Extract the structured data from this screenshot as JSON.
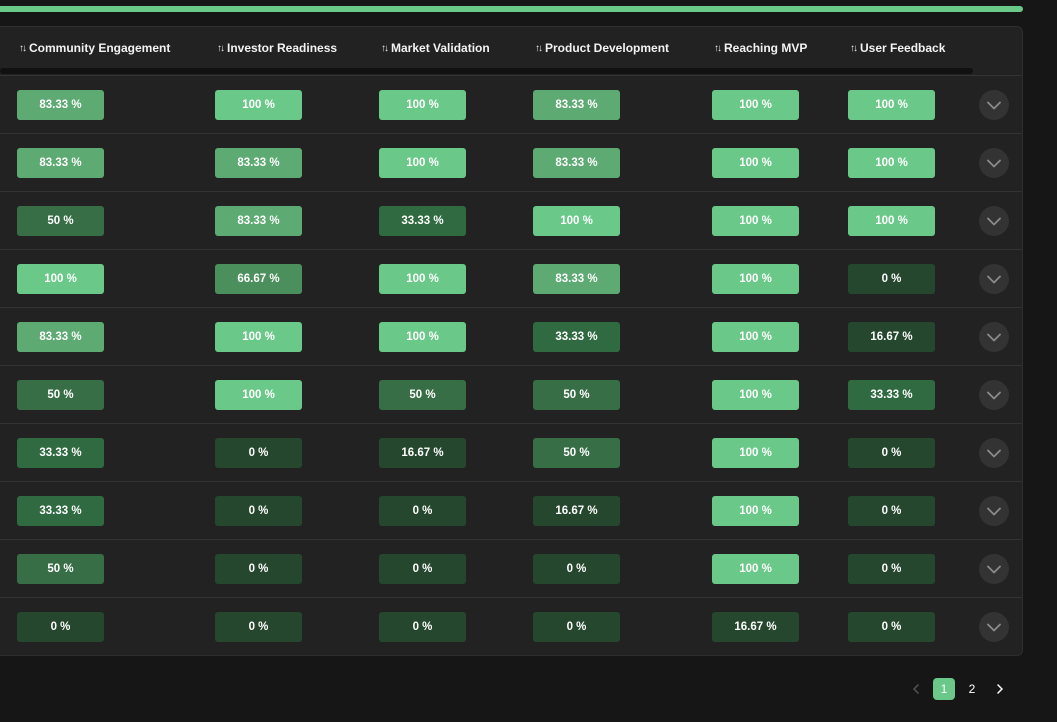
{
  "colors": {
    "accent": "#6ac889",
    "level_100": "#6ac889",
    "level_83": "#5daa73",
    "level_67": "#4b8f5c",
    "level_50": "#386e46",
    "level_33": "#2f6a40",
    "level_17": "#25472d",
    "level_0": "#25472d"
  },
  "table": {
    "columns": [
      {
        "sort_icon": "↑↓",
        "label": "Community Engagement"
      },
      {
        "sort_icon": "↑↓",
        "label": "Investor Readiness"
      },
      {
        "sort_icon": "↑↓",
        "label": "Market Validation"
      },
      {
        "sort_icon": "↑↓",
        "label": "Product Development"
      },
      {
        "sort_icon": "↑↓",
        "label": "Reaching MVP"
      },
      {
        "sort_icon": "↑↓",
        "label": "User Feedback"
      }
    ],
    "rows": [
      {
        "cells": [
          {
            "label": "83.33 %",
            "value": 83.33
          },
          {
            "label": "100 %",
            "value": 100
          },
          {
            "label": "100 %",
            "value": 100
          },
          {
            "label": "83.33 %",
            "value": 83.33
          },
          {
            "label": "100 %",
            "value": 100
          },
          {
            "label": "100 %",
            "value": 100
          }
        ]
      },
      {
        "cells": [
          {
            "label": "83.33 %",
            "value": 83.33
          },
          {
            "label": "83.33 %",
            "value": 83.33
          },
          {
            "label": "100 %",
            "value": 100
          },
          {
            "label": "83.33 %",
            "value": 83.33
          },
          {
            "label": "100 %",
            "value": 100
          },
          {
            "label": "100 %",
            "value": 100
          }
        ]
      },
      {
        "cells": [
          {
            "label": "50 %",
            "value": 50
          },
          {
            "label": "83.33 %",
            "value": 83.33
          },
          {
            "label": "33.33 %",
            "value": 33.33
          },
          {
            "label": "100 %",
            "value": 100
          },
          {
            "label": "100 %",
            "value": 100
          },
          {
            "label": "100 %",
            "value": 100
          }
        ]
      },
      {
        "cells": [
          {
            "label": "100 %",
            "value": 100
          },
          {
            "label": "66.67 %",
            "value": 66.67
          },
          {
            "label": "100 %",
            "value": 100
          },
          {
            "label": "83.33 %",
            "value": 83.33
          },
          {
            "label": "100 %",
            "value": 100
          },
          {
            "label": "0 %",
            "value": 0
          }
        ]
      },
      {
        "cells": [
          {
            "label": "83.33 %",
            "value": 83.33
          },
          {
            "label": "100 %",
            "value": 100
          },
          {
            "label": "100 %",
            "value": 100
          },
          {
            "label": "33.33 %",
            "value": 33.33
          },
          {
            "label": "100 %",
            "value": 100
          },
          {
            "label": "16.67 %",
            "value": 16.67
          }
        ]
      },
      {
        "cells": [
          {
            "label": "50 %",
            "value": 50
          },
          {
            "label": "100 %",
            "value": 100
          },
          {
            "label": "50 %",
            "value": 50
          },
          {
            "label": "50 %",
            "value": 50
          },
          {
            "label": "100 %",
            "value": 100
          },
          {
            "label": "33.33 %",
            "value": 33.33
          }
        ]
      },
      {
        "cells": [
          {
            "label": "33.33 %",
            "value": 33.33
          },
          {
            "label": "0 %",
            "value": 0
          },
          {
            "label": "16.67 %",
            "value": 16.67
          },
          {
            "label": "50 %",
            "value": 50
          },
          {
            "label": "100 %",
            "value": 100
          },
          {
            "label": "0 %",
            "value": 0
          }
        ]
      },
      {
        "cells": [
          {
            "label": "33.33 %",
            "value": 33.33
          },
          {
            "label": "0 %",
            "value": 0
          },
          {
            "label": "0 %",
            "value": 0
          },
          {
            "label": "16.67 %",
            "value": 16.67
          },
          {
            "label": "100 %",
            "value": 100
          },
          {
            "label": "0 %",
            "value": 0
          }
        ]
      },
      {
        "cells": [
          {
            "label": "50 %",
            "value": 50
          },
          {
            "label": "0 %",
            "value": 0
          },
          {
            "label": "0 %",
            "value": 0
          },
          {
            "label": "0 %",
            "value": 0
          },
          {
            "label": "100 %",
            "value": 100
          },
          {
            "label": "0 %",
            "value": 0
          }
        ]
      },
      {
        "cells": [
          {
            "label": "0 %",
            "value": 0
          },
          {
            "label": "0 %",
            "value": 0
          },
          {
            "label": "0 %",
            "value": 0
          },
          {
            "label": "0 %",
            "value": 0
          },
          {
            "label": "16.67 %",
            "value": 16.67
          },
          {
            "label": "0 %",
            "value": 0
          }
        ]
      }
    ],
    "row_action_icon": "chevron-down-icon"
  },
  "pagination": {
    "prev_icon": "chevron-left-icon",
    "pages": [
      "1",
      "2"
    ],
    "current_page": "1",
    "next_icon": "chevron-right-icon"
  }
}
